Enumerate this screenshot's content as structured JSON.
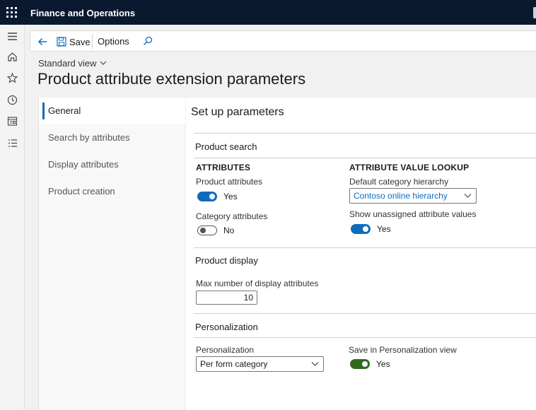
{
  "app": {
    "title": "Finance and Operations"
  },
  "toolbar": {
    "save_label": "Save",
    "options_label": "Options"
  },
  "header": {
    "view_label": "Standard view",
    "page_title": "Product attribute extension parameters"
  },
  "tabs": [
    {
      "label": "General"
    },
    {
      "label": "Search by attributes"
    },
    {
      "label": "Display attributes"
    },
    {
      "label": "Product creation"
    }
  ],
  "main": {
    "section_title": "Set up parameters",
    "product_search": {
      "title": "Product search",
      "attributes_heading": "ATTRIBUTES",
      "product_attributes_label": "Product attributes",
      "product_attributes_value": "Yes",
      "category_attributes_label": "Category attributes",
      "category_attributes_value": "No",
      "lookup_heading": "ATTRIBUTE VALUE LOOKUP",
      "default_hierarchy_label": "Default category hierarchy",
      "default_hierarchy_value": "Contoso online hierarchy",
      "show_unassigned_label": "Show unassigned attribute values",
      "show_unassigned_value": "Yes"
    },
    "product_display": {
      "title": "Product display",
      "max_attributes_label": "Max number of display attributes",
      "max_attributes_value": "10"
    },
    "personalization": {
      "title": "Personalization",
      "personalization_label": "Personalization",
      "personalization_value": "Per form category",
      "save_view_label": "Save in Personalization view",
      "save_view_value": "Yes"
    }
  },
  "colors": {
    "topbar": "#0b1930",
    "accent": "#0f6cbd",
    "highlight": "#f6f06e",
    "toggle_green": "#2f6b1f"
  }
}
